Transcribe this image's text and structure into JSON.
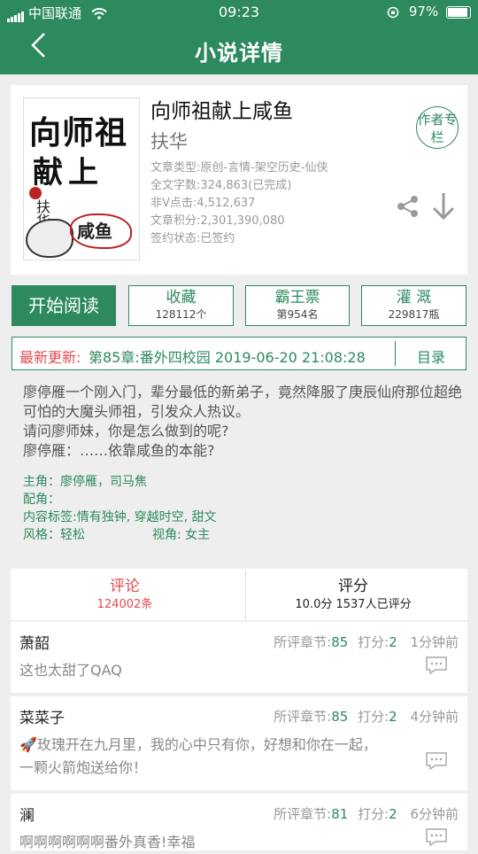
{
  "status": {
    "carrier": "中国联通",
    "time": "09:23",
    "battery": "97%"
  },
  "nav": {
    "title": "小说详情"
  },
  "book": {
    "title": "向师祖献上咸鱼",
    "author": "扶华",
    "author_column": "作者专栏",
    "cover": {
      "line1": "向师祖",
      "line2": "献上",
      "author": "扶华",
      "fish": "咸鱼"
    },
    "meta": [
      "文章类型:原创-言情-架空历史-仙侠",
      "全文字数:324,863(已完成)",
      "非V点击:4,512,637",
      "文章积分:2,301,390,080",
      "签约状态:已签约"
    ]
  },
  "actions": {
    "read": "开始阅读",
    "favorite": {
      "label": "收藏",
      "sub": "128112个"
    },
    "bawang": {
      "label": "霸王票",
      "sub": "第954名"
    },
    "nutrient": {
      "label": "灌 溉",
      "sub": "229817瓶"
    }
  },
  "update": {
    "label": "最新更新:",
    "value": "第85章:番外四校园 2019-06-20 21:08:28",
    "toc": "目录"
  },
  "description": [
    "廖停雁一个刚入门，辈分最低的新弟子，竟然降服了庚辰仙府那位超绝可怕的大魔头师祖，引发众人热议。",
    "请问廖师妹，你是怎么做到的呢?",
    "廖停雁：……依靠咸鱼的本能?"
  ],
  "tags": {
    "protagonist": "主角：廖停雁，司马焦",
    "supporting": "配角：",
    "content": "内容标签:情有独钟, 穿越时空, 甜文",
    "style": "风格：轻松",
    "viewpoint": "视角: 女主"
  },
  "tabs": {
    "comments": {
      "label": "评论",
      "count": "124002条"
    },
    "rating": {
      "label": "评分",
      "summary": "10.0分 1537人已评分"
    }
  },
  "colors": {
    "brand_green": "#2d8a5f",
    "accent_red": "#e5484d"
  },
  "comments": [
    {
      "user": "萧韶",
      "chapter_label": "所评章节:",
      "chapter": "85",
      "score_label": "打分:",
      "score": "2",
      "time": "1分钟前",
      "text": "这也太甜了QAQ"
    },
    {
      "user": "菜菜子",
      "chapter_label": "所评章节:",
      "chapter": "85",
      "score_label": "打分:",
      "score": "2",
      "time": "4分钟前",
      "text": "🚀玫瑰开在九月里，我的心中只有你，好想和你在一起，一颗火箭炮送给你！"
    },
    {
      "user": "澜",
      "chapter_label": "所评章节:",
      "chapter": "81",
      "score_label": "打分:",
      "score": "2",
      "time": "6分钟前",
      "text": "啊啊啊啊啊啊番外真香!幸福"
    }
  ]
}
